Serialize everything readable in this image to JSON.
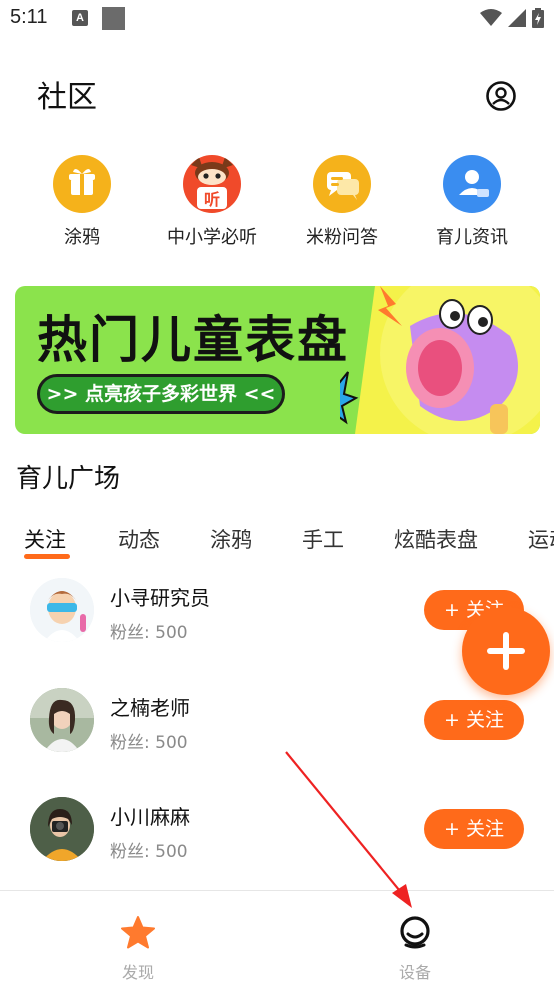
{
  "status_bar": {
    "time": "5:11",
    "keyboard_indicator": "A"
  },
  "header": {
    "title": "社区",
    "profile_icon": "user-circle-icon"
  },
  "quick_links": [
    {
      "label": "涂鸦",
      "icon": "gift-icon",
      "color": "#f5b21b"
    },
    {
      "label": "中小学必听",
      "icon": "listen-character-icon",
      "color": "#f04a2a"
    },
    {
      "label": "米粉问答",
      "icon": "chat-bubble-icon",
      "color": "#f5b21b"
    },
    {
      "label": "育儿资讯",
      "icon": "person-card-icon",
      "color": "#3a8df0"
    }
  ],
  "banner": {
    "title": "热门儿童表盘",
    "subtitle": ">> 点亮孩子多彩世界 <<",
    "image": "megaphone-illustration",
    "bg_color": "#8be34c"
  },
  "section": {
    "title": "育儿广场"
  },
  "tabs": [
    {
      "label": "关注",
      "active": true
    },
    {
      "label": "动态",
      "active": false
    },
    {
      "label": "涂鸦",
      "active": false
    },
    {
      "label": "手工",
      "active": false
    },
    {
      "label": "炫酷表盘",
      "active": false
    },
    {
      "label": "运动",
      "active": false
    }
  ],
  "users": [
    {
      "name": "小寻研究员",
      "fans": "粉丝: 500",
      "follow_label": "+ 关注"
    },
    {
      "name": "之楠老师",
      "fans": "粉丝: 500",
      "follow_label": "+ 关注"
    },
    {
      "name": "小川麻麻",
      "fans": "粉丝: 500",
      "follow_label": "+ 关注"
    }
  ],
  "fab": {
    "icon": "plus-icon"
  },
  "bottom_nav": [
    {
      "label": "发现",
      "icon": "star-icon",
      "active": true,
      "color": "#ff7a2e"
    },
    {
      "label": "设备",
      "icon": "smile-device-icon",
      "active": false,
      "color": "#111111"
    }
  ],
  "accent_color": "#ff6a1a",
  "annotation": {
    "type": "red-arrow",
    "color": "#ee2222"
  }
}
